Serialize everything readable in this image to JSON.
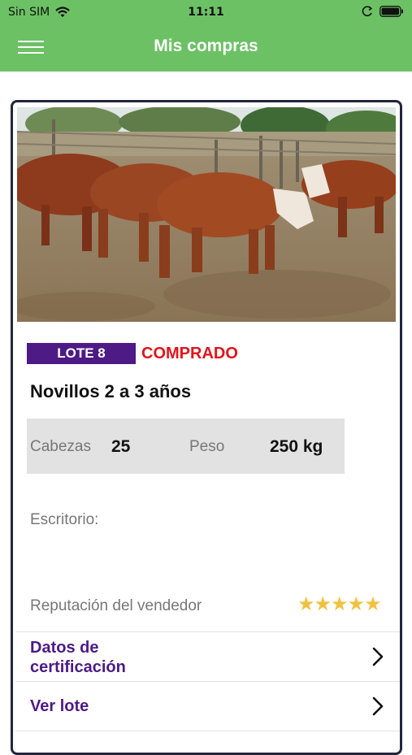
{
  "status_bar": {
    "carrier": "Sin SIM",
    "time": "11:11"
  },
  "nav": {
    "title": "Mis compras"
  },
  "lot": {
    "badge": "LOTE 8",
    "status": "COMPRADO",
    "title": "Novillos 2 a 3 años",
    "heads_label": "Cabezas",
    "heads_value": "25",
    "weight_label": "Peso",
    "weight_value": "250 kg",
    "office_label": "Escritorio:",
    "reputation_label": "Reputación del vendedor",
    "reputation_stars": "★★★★★",
    "rating": 5
  },
  "links": {
    "certification": "Datos de certificación",
    "view_lot": "Ver lote"
  },
  "colors": {
    "header_green": "#6cc164",
    "badge_purple": "#4d1a86",
    "status_red": "#e0141b",
    "star_yellow": "#f0c242"
  }
}
